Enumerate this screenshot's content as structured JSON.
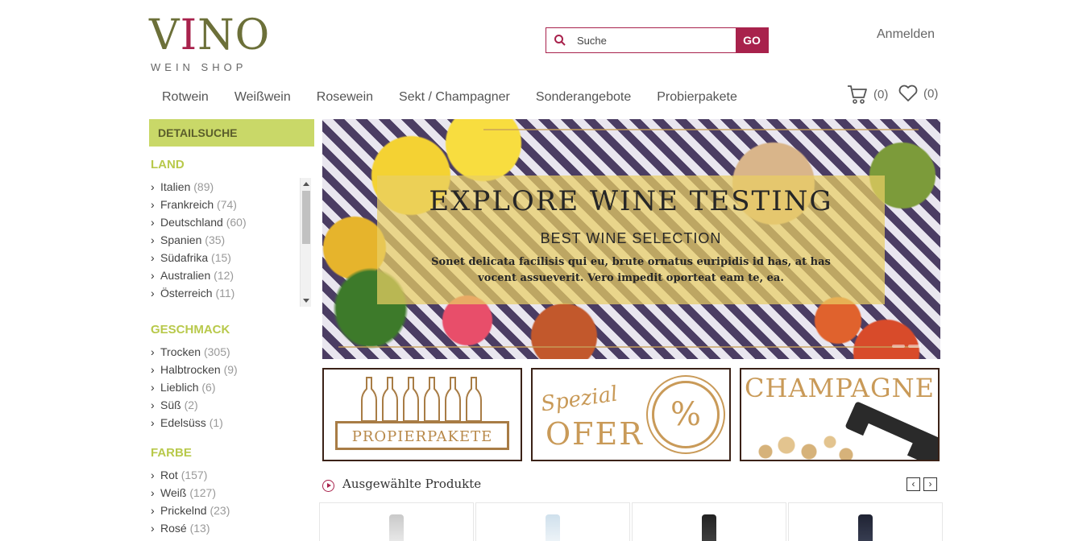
{
  "header": {
    "logo_main_v": "V",
    "logo_main_i": "I",
    "logo_main_rest": "NO",
    "logo_sub": "WEIN SHOP",
    "search_placeholder": "Suche",
    "search_button": "GO",
    "login": "Anmelden",
    "cart_count": "(0)",
    "wishlist_count": "(0)"
  },
  "nav": {
    "items": [
      {
        "label": "Rotwein"
      },
      {
        "label": "Weißwein"
      },
      {
        "label": "Rosewein"
      },
      {
        "label": "Sekt / Champagner"
      },
      {
        "label": "Sonderangebote"
      },
      {
        "label": "Probierpakete"
      }
    ]
  },
  "sidebar": {
    "detail_title": "DETAILSUCHE",
    "land": {
      "title": "LAND",
      "items": [
        {
          "label": "Italien",
          "count": "(89)"
        },
        {
          "label": "Frankreich",
          "count": "(74)"
        },
        {
          "label": "Deutschland",
          "count": "(60)"
        },
        {
          "label": "Spanien",
          "count": "(35)"
        },
        {
          "label": "Südafrika",
          "count": "(15)"
        },
        {
          "label": "Australien",
          "count": "(12)"
        },
        {
          "label": "Österreich",
          "count": "(11)"
        }
      ]
    },
    "geschmack": {
      "title": "GESCHMACK",
      "items": [
        {
          "label": "Trocken",
          "count": "(305)"
        },
        {
          "label": "Halbtrocken",
          "count": "(9)"
        },
        {
          "label": "Lieblich",
          "count": "(6)"
        },
        {
          "label": "Süß",
          "count": "(2)"
        },
        {
          "label": "Edelsüss",
          "count": "(1)"
        }
      ]
    },
    "farbe": {
      "title": "FARBE",
      "items": [
        {
          "label": "Rot",
          "count": "(157)"
        },
        {
          "label": "Weiß",
          "count": "(127)"
        },
        {
          "label": "Prickelnd",
          "count": "(23)"
        },
        {
          "label": "Rosé",
          "count": "(13)"
        }
      ]
    }
  },
  "hero": {
    "title": "EXPLORE WINE TESTING",
    "subtitle": "BEST WINE SELECTION",
    "text": "Sonet delicata facilisis qui eu, brute ornatus euripidis id has, at has vocent assueverit. Vero impedit oporteat eam te, ea."
  },
  "banners": {
    "probier": "PROPIERPAKETE",
    "spezial": "Spezial",
    "ofer": "OFER",
    "percent": "%",
    "champagne": "CHAMPAGNE"
  },
  "featured": {
    "title": "Ausgewählte Produkte",
    "prev": "‹",
    "next": "›"
  },
  "colors": {
    "brand_red": "#a8224c",
    "olive": "#6c7039",
    "lime": "#c9d868",
    "gold": "#b8894a"
  }
}
